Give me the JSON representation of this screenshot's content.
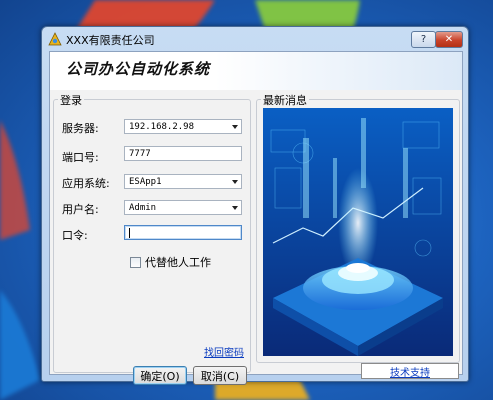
{
  "window": {
    "title": "XXX有限责任公司",
    "help_glyph": "?",
    "close_glyph": "✕",
    "banner_title": "公司办公自动化系统"
  },
  "login": {
    "group_label": "登录",
    "server_label": "服务器:",
    "server_value": "192.168.2.98",
    "port_label": "端口号:",
    "port_value": "7777",
    "app_label": "应用系统:",
    "app_value": "ESApp1",
    "user_label": "用户名:",
    "user_value": "Admin",
    "password_label": "口令:",
    "password_value": "",
    "proxy_checkbox_label": "代替他人工作",
    "proxy_checked": false,
    "ok_label": "确定(O)",
    "cancel_label": "取消(C)",
    "retrieve_link": "找回密码"
  },
  "news": {
    "group_label": "最新消息"
  },
  "footer": {
    "support_link": "技术支持"
  },
  "colors": {
    "accent": "#3c7fb1",
    "link": "#0b3cbf",
    "close_button": "#c9432b"
  }
}
